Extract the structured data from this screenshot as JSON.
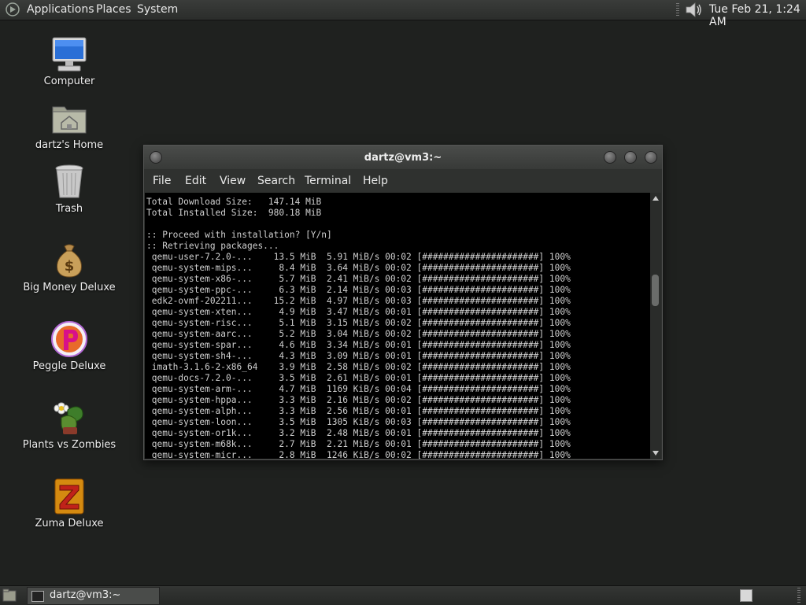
{
  "top_panel": {
    "menus": [
      "Applications",
      "Places",
      "System"
    ],
    "clock": "Tue Feb 21,  1:24 AM"
  },
  "desktop_icons": [
    {
      "label": "Computer",
      "icon": "computer-icon"
    },
    {
      "label": "dartz's Home",
      "icon": "home-folder-icon"
    },
    {
      "label": "Trash",
      "icon": "trash-icon"
    },
    {
      "label": "Big Money Deluxe",
      "icon": "money-bag-icon"
    },
    {
      "label": "Peggle Deluxe",
      "icon": "peggle-icon"
    },
    {
      "label": "Plants vs Zombies",
      "icon": "plants-vs-zombies-icon"
    },
    {
      "label": "Zuma Deluxe",
      "icon": "zuma-icon"
    }
  ],
  "terminal": {
    "title": "dartz@vm3:~",
    "menus": [
      "File",
      "Edit",
      "View",
      "Search",
      "Terminal",
      "Help"
    ],
    "lines": [
      "Total Download Size:   147.14 MiB",
      "Total Installed Size:  980.18 MiB",
      "",
      ":: Proceed with installation? [Y/n]",
      ":: Retrieving packages...",
      " qemu-user-7.2.0-...    13.5 MiB  5.91 MiB/s 00:02 [######################] 100%",
      " qemu-system-mips...     8.4 MiB  3.64 MiB/s 00:02 [######################] 100%",
      " qemu-system-x86-...     5.7 MiB  2.41 MiB/s 00:02 [######################] 100%",
      " qemu-system-ppc-...     6.3 MiB  2.14 MiB/s 00:03 [######################] 100%",
      " edk2-ovmf-202211...    15.2 MiB  4.97 MiB/s 00:03 [######################] 100%",
      " qemu-system-xten...     4.9 MiB  3.47 MiB/s 00:01 [######################] 100%",
      " qemu-system-risc...     5.1 MiB  3.15 MiB/s 00:02 [######################] 100%",
      " qemu-system-aarc...     5.2 MiB  3.04 MiB/s 00:02 [######################] 100%",
      " qemu-system-spar...     4.6 MiB  3.34 MiB/s 00:01 [######################] 100%",
      " qemu-system-sh4-...     4.3 MiB  3.09 MiB/s 00:01 [######################] 100%",
      " imath-3.1.6-2-x86_64    3.9 MiB  2.58 MiB/s 00:02 [######################] 100%",
      " qemu-docs-7.2.0-...     3.5 MiB  2.61 MiB/s 00:01 [######################] 100%",
      " qemu-system-arm-...     4.7 MiB  1169 KiB/s 00:04 [######################] 100%",
      " qemu-system-hppa...     3.3 MiB  2.16 MiB/s 00:02 [######################] 100%",
      " qemu-system-alph...     3.3 MiB  2.56 MiB/s 00:01 [######################] 100%",
      " qemu-system-loon...     3.5 MiB  1305 KiB/s 00:03 [######################] 100%",
      " qemu-system-or1k...     3.2 MiB  2.48 MiB/s 00:01 [######################] 100%",
      " qemu-system-m68k...     2.7 MiB  2.21 MiB/s 00:01 [######################] 100%",
      " qemu-system-micr...     2.8 MiB  1246 KiB/s 00:02 [######################] 100%"
    ]
  },
  "bottom_panel": {
    "task_label": "dartz@vm3:~"
  },
  "colors": {
    "desktop_bg": "#1f211f",
    "terminal_bg": "#000000",
    "terminal_fg": "#d0d0d0"
  }
}
